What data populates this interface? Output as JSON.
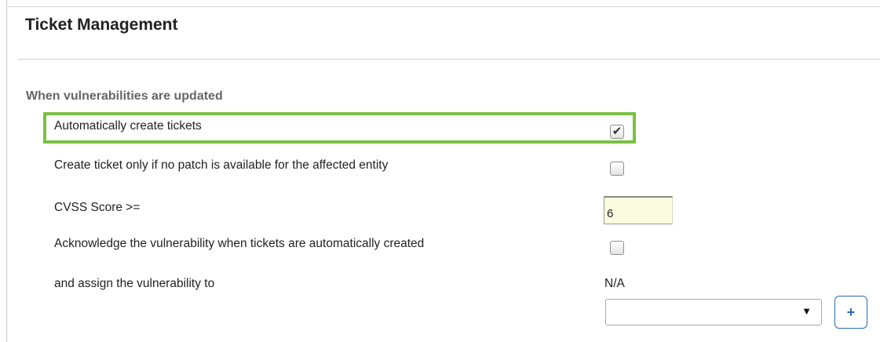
{
  "panel": {
    "title": "Ticket Management"
  },
  "section": {
    "label": "When vulnerabilities are updated"
  },
  "settings": {
    "auto_create": {
      "label": "Automatically create tickets",
      "checked": true
    },
    "no_patch_only": {
      "label": "Create ticket only if no patch is available for the affected entity",
      "checked": false
    },
    "cvss": {
      "label": "CVSS Score >=",
      "value": "6"
    },
    "acknowledge": {
      "label": "Acknowledge the vulnerability when tickets are automatically created",
      "checked": false
    },
    "assign": {
      "label": "and assign the vulnerability to",
      "current": "N/A",
      "selected": ""
    }
  },
  "icons": {
    "check": "✔",
    "dropdown_arrow": "▼",
    "add": "+"
  },
  "colors": {
    "highlight": "#7ac142",
    "button_accent": "#2a6db5",
    "input_bg": "#fbfbe0"
  }
}
